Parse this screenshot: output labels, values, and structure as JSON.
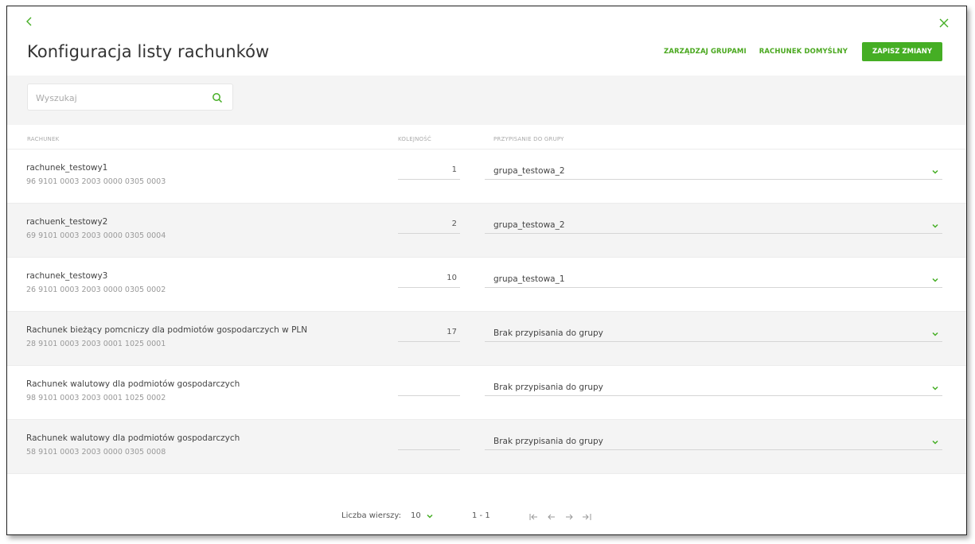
{
  "header": {
    "title": "Konfiguracja listy rachunków",
    "manage_groups": "ZARZĄDZAJ GRUPAMI",
    "default_account": "RACHUNEK DOMYŚLNY",
    "save_changes": "ZAPISZ ZMIANY"
  },
  "search": {
    "placeholder": "Wyszukaj"
  },
  "columns": {
    "account": "RACHUNEK",
    "order": "KOLEJNOŚĆ",
    "group": "PRZYPISANIE DO GRUPY"
  },
  "rows": [
    {
      "name": "rachunek_testowy1",
      "number": "96 9101 0003 2003 0000 0305 0003",
      "order": "1",
      "group": "grupa_testowa_2"
    },
    {
      "name": "rachuenk_testowy2",
      "number": "69 9101 0003 2003 0000 0305 0004",
      "order": "2",
      "group": "grupa_testowa_2"
    },
    {
      "name": "rachunek_testowy3",
      "number": "26 9101 0003 2003 0000 0305 0002",
      "order": "10",
      "group": "grupa_testowa_1"
    },
    {
      "name": "Rachunek bieżący pomcniczy dla podmiotów gospodarczych w PLN",
      "number": "28 9101 0003 2003 0001 1025 0001",
      "order": "17",
      "group": "Brak przypisania do grupy"
    },
    {
      "name": "Rachunek walutowy dla podmiotów gospodarczych",
      "number": "98 9101 0003 2003 0001 1025 0002",
      "order": "",
      "group": "Brak przypisania do grupy"
    },
    {
      "name": "Rachunek walutowy dla podmiotów gospodarczych",
      "number": "58 9101 0003 2003 0000 0305 0008",
      "order": "",
      "group": "Brak przypisania do grupy"
    }
  ],
  "pagination": {
    "rows_label": "Liczba wierszy:",
    "rows_value": "10",
    "range": "1 - 1"
  },
  "colors": {
    "accent": "#45ae24",
    "link": "#4aa81f"
  },
  "icons": {
    "back": "chevron-left-icon",
    "close": "close-icon",
    "search": "search-icon",
    "dropdown": "chevron-down-icon",
    "first": "first-page-icon",
    "prev": "prev-page-icon",
    "next": "next-page-icon",
    "last": "last-page-icon"
  }
}
